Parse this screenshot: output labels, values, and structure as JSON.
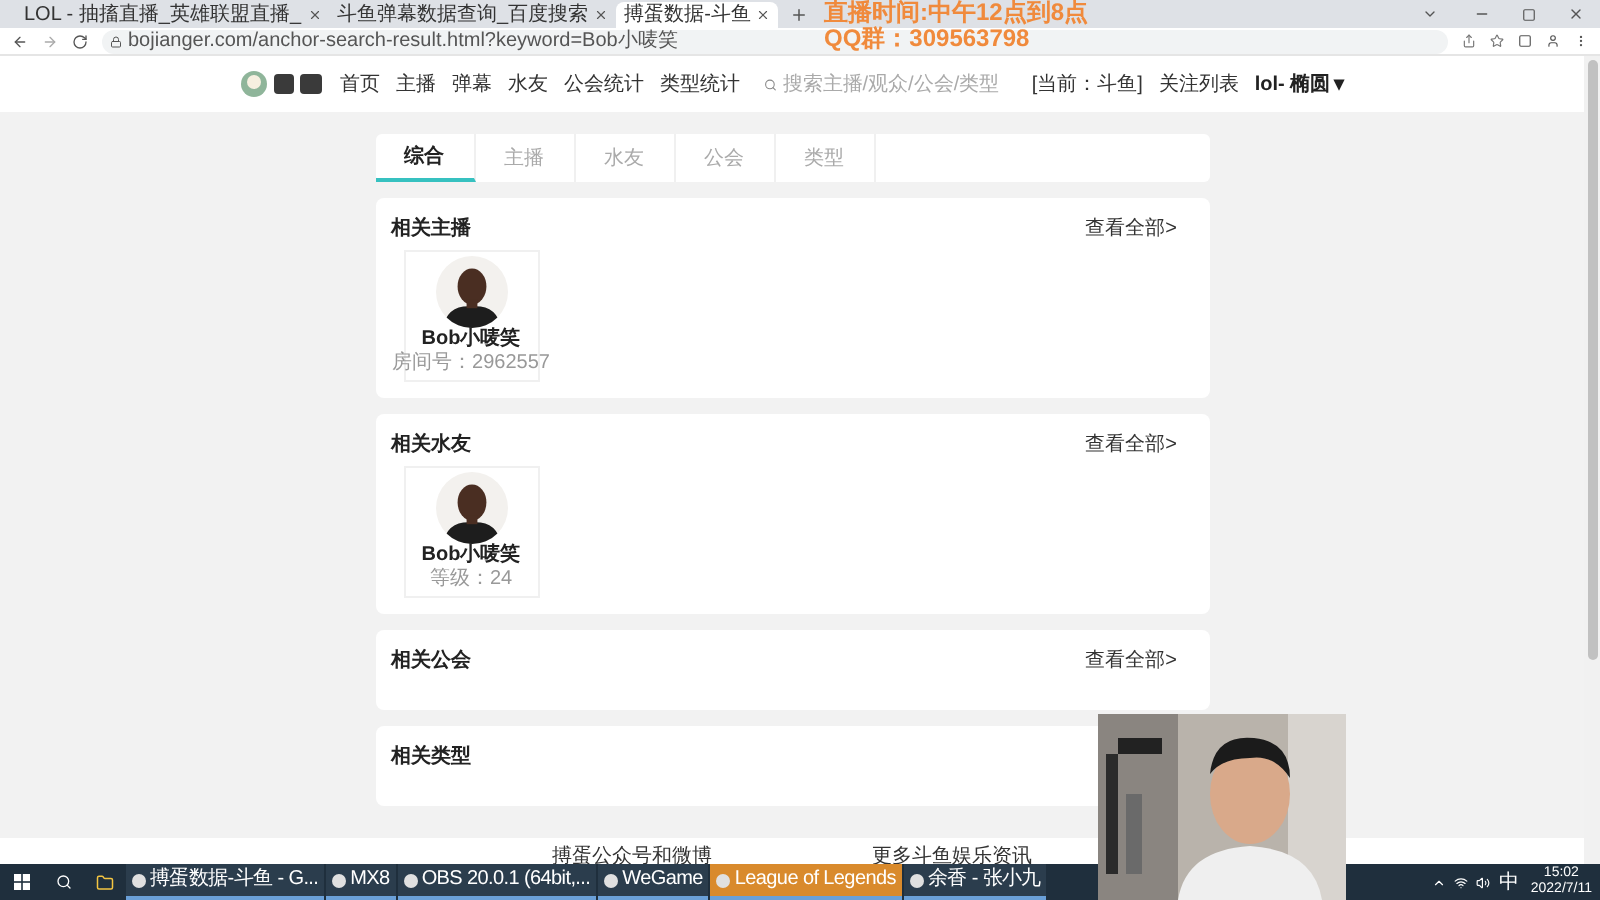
{
  "browser": {
    "tabs": [
      {
        "title": "LOL - 抽搐直播_英雄联盟直播_",
        "selected": false
      },
      {
        "title": "斗鱼弹幕数据查询_百度搜索",
        "selected": false
      },
      {
        "title": "搏蛋数据-斗鱼",
        "selected": true
      }
    ],
    "url": "bojianger.com/anchor-search-result.html?keyword=Bob小唛笑"
  },
  "overlay": {
    "line_1": "直播时间:中午12点到8点",
    "line_2": "QQ群：309563798"
  },
  "site_header": {
    "nav": [
      "首页",
      "主播",
      "弹幕",
      "水友",
      "公会统计",
      "类型统计"
    ],
    "search": {
      "placeholder": "搜索主播/观众/公会/类型"
    },
    "platform": "[当前：斗鱼]",
    "follow": "关注列表",
    "user": "lol- 椭圆",
    "user_caret": "▾"
  },
  "result_tabs": [
    {
      "label": "综合",
      "selected": true
    },
    {
      "label": "主播",
      "selected": false
    },
    {
      "label": "水友",
      "selected": false
    },
    {
      "label": "公会",
      "selected": false
    },
    {
      "label": "类型",
      "selected": false
    }
  ],
  "sections": [
    {
      "title": "相关主播",
      "more": "查看全部>",
      "cards": [
        {
          "name": "Bob小唛笑",
          "detail": "房间号：2962557"
        }
      ]
    },
    {
      "title": "相关水友",
      "more": "查看全部>",
      "cards": [
        {
          "name": "Bob小唛笑",
          "detail": "等级：24"
        }
      ]
    },
    {
      "title": "相关公会",
      "more": "查看全部>"
    },
    {
      "title": "相关类型"
    }
  ],
  "footer": [
    "搏蛋公众号和微博",
    "更多斗鱼娱乐资讯"
  ],
  "taskbar": {
    "apps": [
      {
        "label": "搏蛋数据-斗鱼 - G...",
        "selected": false
      },
      {
        "label": "MX8",
        "selected": false
      },
      {
        "label": "OBS 20.0.1 (64bit,...",
        "selected": false
      },
      {
        "label": "WeGame",
        "selected": false
      },
      {
        "label": "League of Legends",
        "selected": true
      },
      {
        "label": "余香 - 张小九",
        "selected": false
      }
    ],
    "ime": "中",
    "time": "15:02",
    "date": "2022/7/11"
  }
}
